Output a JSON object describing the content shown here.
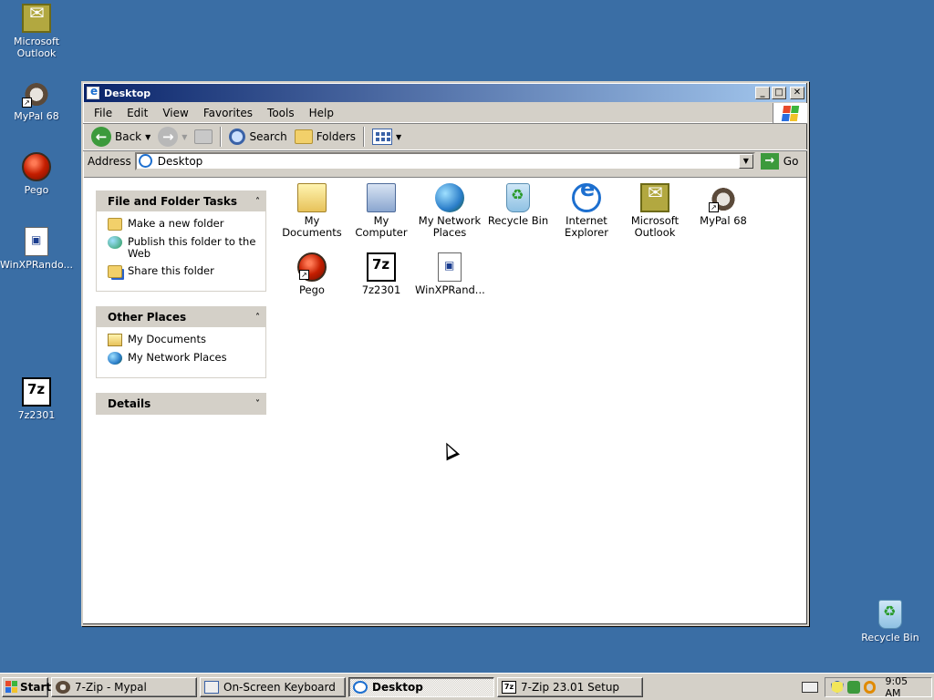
{
  "desktop": {
    "icons": [
      {
        "label": "Microsoft Outlook",
        "icon": "outlook-icon"
      },
      {
        "label": "MyPal 68",
        "icon": "mypal-icon"
      },
      {
        "label": "Pego",
        "icon": "pego-icon"
      },
      {
        "label": "WinXPRando...",
        "icon": "document-icon"
      },
      {
        "label": "7z2301",
        "icon": "7zip-icon"
      },
      {
        "label": "Recycle Bin",
        "icon": "recycle-bin-icon"
      }
    ]
  },
  "window": {
    "title": "Desktop",
    "buttons": {
      "minimize": "_",
      "maximize": "□",
      "close": "✕"
    },
    "menu": [
      "File",
      "Edit",
      "View",
      "Favorites",
      "Tools",
      "Help"
    ],
    "toolbar": {
      "back": "Back",
      "search": "Search",
      "folders": "Folders"
    },
    "address": {
      "label": "Address",
      "value": "Desktop",
      "go": "Go"
    },
    "taskpane": {
      "file_tasks": {
        "title": "File and Folder Tasks",
        "items": [
          "Make a new folder",
          "Publish this folder to the Web",
          "Share this folder"
        ]
      },
      "other_places": {
        "title": "Other Places",
        "items": [
          "My Documents",
          "My Network Places"
        ]
      },
      "details": {
        "title": "Details"
      }
    },
    "items": [
      {
        "label": "My Documents",
        "icon": "my-documents-icon"
      },
      {
        "label": "My Computer",
        "icon": "my-computer-icon"
      },
      {
        "label": "My Network Places",
        "icon": "network-places-icon"
      },
      {
        "label": "Recycle Bin",
        "icon": "recycle-bin-icon"
      },
      {
        "label": "Internet Explorer",
        "icon": "internet-explorer-icon"
      },
      {
        "label": "Microsoft Outlook",
        "icon": "outlook-icon"
      },
      {
        "label": "MyPal 68",
        "icon": "mypal-icon"
      },
      {
        "label": "Pego",
        "icon": "pego-icon"
      },
      {
        "label": "7z2301",
        "icon": "7zip-icon"
      },
      {
        "label": "WinXPRand...",
        "icon": "document-icon"
      }
    ]
  },
  "taskbar": {
    "start": "Start",
    "tasks": [
      {
        "label": "7-Zip - Mypal",
        "active": false
      },
      {
        "label": "On-Screen Keyboard",
        "active": false
      },
      {
        "label": "Desktop",
        "active": true
      },
      {
        "label": "7-Zip 23.01 Setup",
        "active": false
      }
    ],
    "clock": "9:05 AM"
  },
  "colors": {
    "desktop": "#3a6ea5",
    "titlebar_start": "#0a246a",
    "titlebar_end": "#a6caf0",
    "face": "#d4d0c8"
  }
}
